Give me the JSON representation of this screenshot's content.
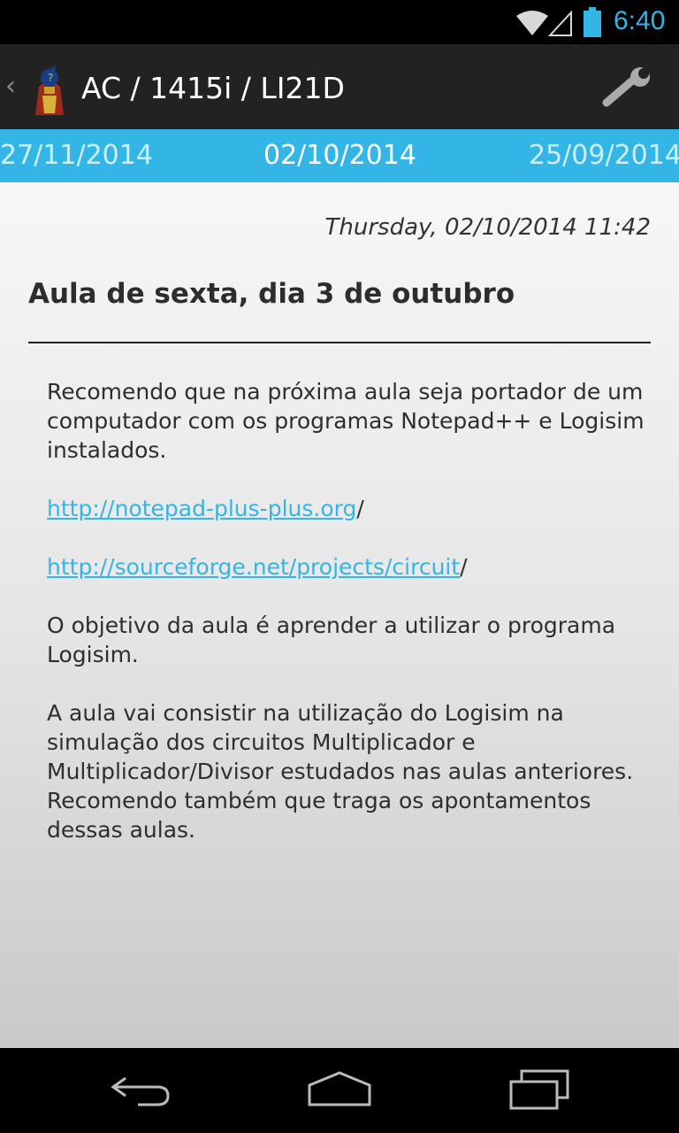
{
  "status_bar": {
    "time": "6:40",
    "icons": [
      "wifi-icon",
      "signal-icon",
      "battery-icon"
    ]
  },
  "action_bar": {
    "title": "AC / 1415i / LI21D",
    "icons": [
      "up-caret-icon",
      "app-logo-icon",
      "wrench-icon"
    ]
  },
  "date_strip": {
    "previous": "27/11/2014",
    "current": "02/10/2014",
    "next": "25/09/2014"
  },
  "post": {
    "timestamp": "Thursday, 02/10/2014 11:42",
    "title": "Aula de sexta, dia 3 de outubro",
    "paragraph1": "Recomendo que na próxima aula seja portador de um computador com os programas Notepad++ e Logisim instalados.",
    "link1": "http://notepad-plus-plus.org",
    "link1_suffix": "/",
    "link2": "http://sourceforge.net/projects/circuit",
    "link2_suffix": "/",
    "paragraph2": "O objetivo da aula é aprender a utilizar o programa Logisim.",
    "paragraph3": "A aula vai consistir na utilização do Logisim na simulação dos circuitos Multiplicador e Multiplicador/Divisor estudados nas aulas anteriores. Recomendo também que traga os apontamentos dessas aulas."
  },
  "nav_bar": {
    "icons": [
      "back-icon",
      "home-icon",
      "recent-apps-icon"
    ]
  },
  "colors": {
    "accent": "#33b5e5",
    "action_bar": "#222222"
  }
}
